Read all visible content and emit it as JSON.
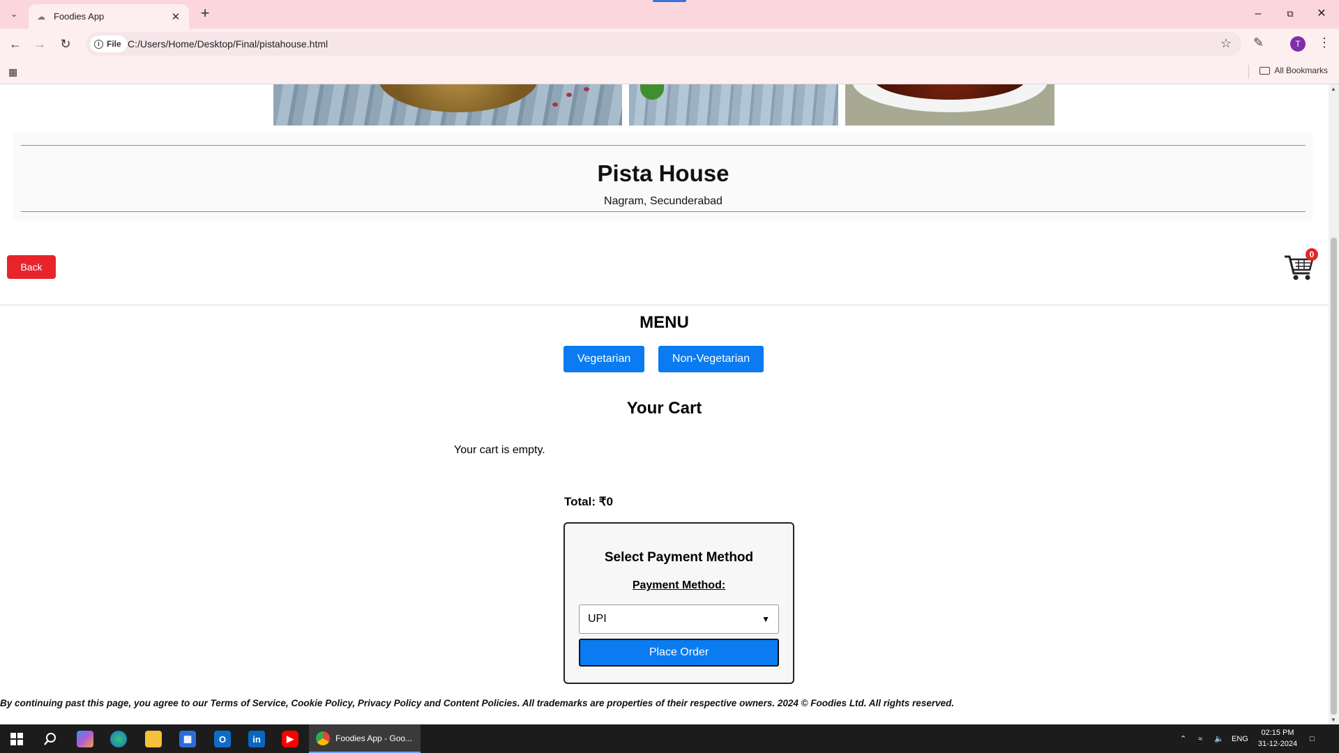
{
  "browser": {
    "tab_title": "Foodies App",
    "site_info_label": "File",
    "url": "C:/Users/Home/Desktop/Final/pistahouse.html",
    "bookmarks_label": "All Bookmarks",
    "profile_initial": "T"
  },
  "restaurant": {
    "name": "Pista House",
    "location": "Nagram, Secunderabad"
  },
  "actions": {
    "back_label": "Back",
    "cart_count": "0"
  },
  "menu": {
    "title": "MENU",
    "categories": [
      "Vegetarian",
      "Non-Vegetarian"
    ]
  },
  "cart": {
    "title": "Your Cart",
    "empty_message": "Your cart is empty.",
    "total_label": "Total: ₹0"
  },
  "payment": {
    "title": "Select Payment Method",
    "label": "Payment Method:",
    "selected": "UPI",
    "place_order_label": "Place Order"
  },
  "footer": {
    "text": "By continuing past this page, you agree to our Terms of Service, Cookie Policy, Privacy Policy and Content Policies. All trademarks are properties of their respective owners. 2024 © Foodies Ltd. All rights reserved."
  },
  "taskbar": {
    "active_app_label": "Foodies App - Goo...",
    "language": "ENG",
    "time": "02:15 PM",
    "date": "31-12-2024"
  },
  "colors": {
    "accent_blue": "#0a7bf0",
    "back_red": "#e8242b",
    "chrome_pink": "#fbd6dc"
  },
  "icons": [
    "chevron-down-icon",
    "close-icon",
    "plus-icon",
    "back-arrow-icon",
    "forward-arrow-icon",
    "reload-icon",
    "info-icon",
    "star-icon",
    "puzzle-icon",
    "kebab-menu-icon",
    "apps-grid-icon",
    "folder-icon",
    "cart-icon",
    "windows-start-icon",
    "search-icon",
    "copilot-icon",
    "edge-icon",
    "file-explorer-icon",
    "store-icon",
    "outlook-icon",
    "linkedin-icon",
    "youtube-icon",
    "chrome-icon",
    "wifi-icon",
    "volume-icon",
    "notification-icon"
  ]
}
